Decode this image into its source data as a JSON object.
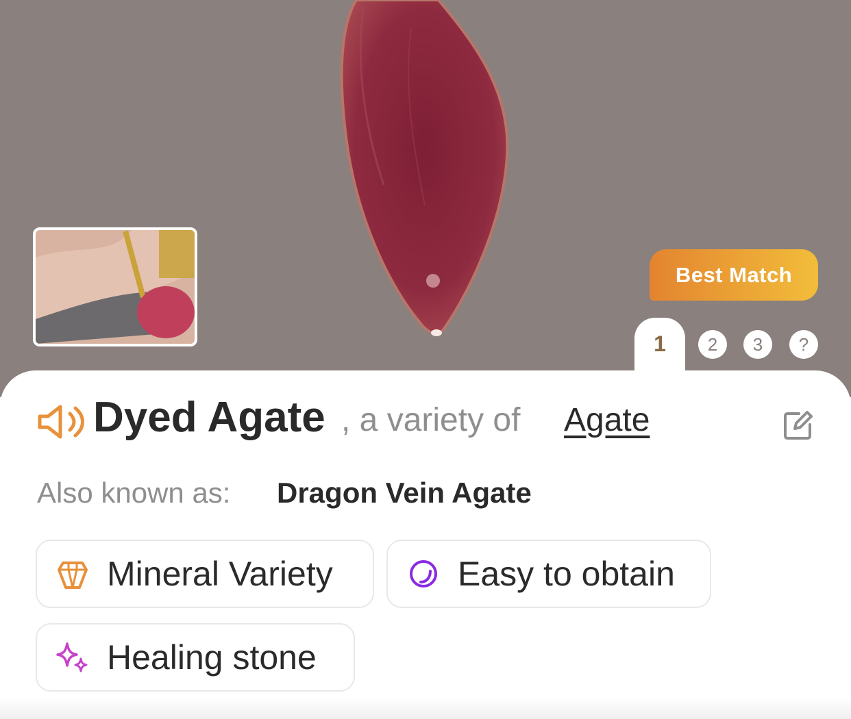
{
  "hero": {
    "badge_label": "Best Match",
    "tabs": [
      "1",
      "2",
      "3",
      "?"
    ],
    "active_tab": "1"
  },
  "result": {
    "name": "Dyed Agate",
    "variety_text": ", a variety of ",
    "parent_link": "Agate",
    "aka_label": "Also known as:",
    "aka_value": "Dragon Vein Agate"
  },
  "chips": [
    {
      "label": "Mineral Variety",
      "icon": "crystal-icon",
      "color": "#e8913a"
    },
    {
      "label": "Easy to obtain",
      "icon": "circle-icon",
      "color": "#8a2be2"
    },
    {
      "label": "Healing stone",
      "icon": "sparkle-icon",
      "color": "#c542c8"
    }
  ],
  "colors": {
    "accent_orange": "#e8913a",
    "badge_gradient_start": "#e38430",
    "badge_gradient_end": "#f2bd3a",
    "text_dark": "#2a2a2a",
    "text_muted": "#8e8e8e",
    "photo_background": "#8a807d"
  }
}
